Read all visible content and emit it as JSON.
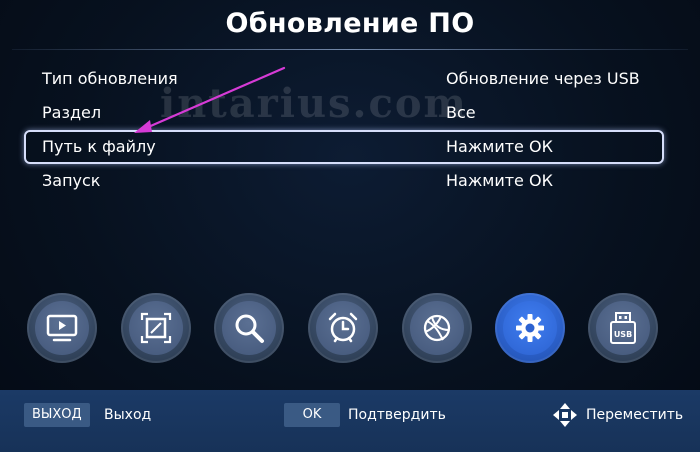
{
  "screen": {
    "title": "Обновление ПО"
  },
  "watermark": "intarius.com",
  "menu": {
    "items": [
      {
        "label": "Тип обновления",
        "value": "Обновление через USB",
        "selected": false
      },
      {
        "label": "Раздел",
        "value": "Все",
        "selected": false
      },
      {
        "label": "Путь к файлу",
        "value": "Нажмите ОК",
        "selected": true
      },
      {
        "label": "Запуск",
        "value": "Нажмите ОК",
        "selected": false
      }
    ]
  },
  "annotation": {
    "arrow_color": "#d63bd6"
  },
  "icon_bar": {
    "items": [
      {
        "icon": "tv-icon",
        "active": false
      },
      {
        "icon": "picture-icon",
        "active": false
      },
      {
        "icon": "search-icon",
        "active": false
      },
      {
        "icon": "alarm-clock-icon",
        "active": false
      },
      {
        "icon": "globe-icon",
        "active": false
      },
      {
        "icon": "gear-icon",
        "active": true
      },
      {
        "icon": "usb-icon",
        "active": false,
        "label": "USB"
      }
    ]
  },
  "footer": {
    "exit_key": "ВЫХОД",
    "exit_hint": "Выход",
    "ok_key": "OK",
    "ok_hint": "Подтвердить",
    "move_icon": "four-way-arrows-icon",
    "move_hint": "Переместить"
  },
  "colors": {
    "accent": "#2c62d0",
    "footer_bg": "#1b3a66",
    "key_bg": "#3a5a84",
    "selection_border": "#d6defa"
  }
}
